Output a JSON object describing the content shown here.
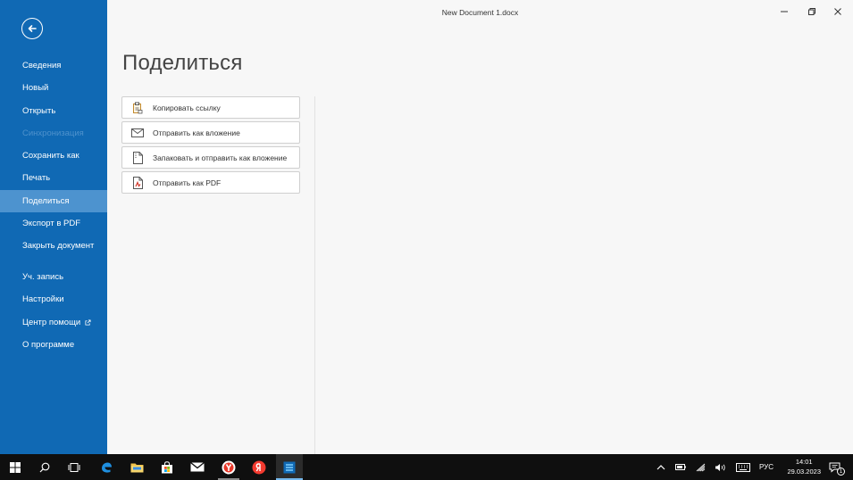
{
  "window": {
    "title": "New Document 1.docx"
  },
  "sidebar": {
    "menu_primary": [
      {
        "label": "Сведения",
        "state": "normal"
      },
      {
        "label": "Новый",
        "state": "normal"
      },
      {
        "label": "Открыть",
        "state": "normal"
      },
      {
        "label": "Синхронизация",
        "state": "disabled"
      },
      {
        "label": "Сохранить как",
        "state": "normal"
      },
      {
        "label": "Печать",
        "state": "normal"
      },
      {
        "label": "Поделиться",
        "state": "active"
      },
      {
        "label": "Экспорт в PDF",
        "state": "normal"
      },
      {
        "label": "Закрыть документ",
        "state": "normal"
      }
    ],
    "menu_secondary": [
      {
        "label": "Уч. запись"
      },
      {
        "label": "Настройки"
      },
      {
        "label": "Центр помощи",
        "icon": "external-link-icon"
      },
      {
        "label": "О программе"
      }
    ]
  },
  "main": {
    "title": "Поделиться",
    "share_options": [
      {
        "label": "Копировать ссылку",
        "icon": "clipboard-icon"
      },
      {
        "label": "Отправить как вложение",
        "icon": "envelope-icon"
      },
      {
        "label": "Запаковать и отправить как вложение",
        "icon": "zip-file-icon"
      },
      {
        "label": "Отправить как PDF",
        "icon": "pdf-file-icon"
      }
    ]
  },
  "taskbar": {
    "icons": [
      "windows-start-icon",
      "search-icon",
      "task-view-icon",
      "edge-icon",
      "file-explorer-icon",
      "store-icon",
      "mail-icon",
      "yandex-browser-icon",
      "yandex-icon",
      "office-app-icon"
    ],
    "tray": {
      "language": "РУС",
      "time": "14:01",
      "date": "29.03.2023",
      "notifications_count": "1"
    }
  },
  "colors": {
    "sidebar_bg": "#1069b4",
    "sidebar_active": "#4d93cf",
    "sidebar_disabled_text": "#4f92cc",
    "taskbar_bg": "#0f0f0f"
  }
}
